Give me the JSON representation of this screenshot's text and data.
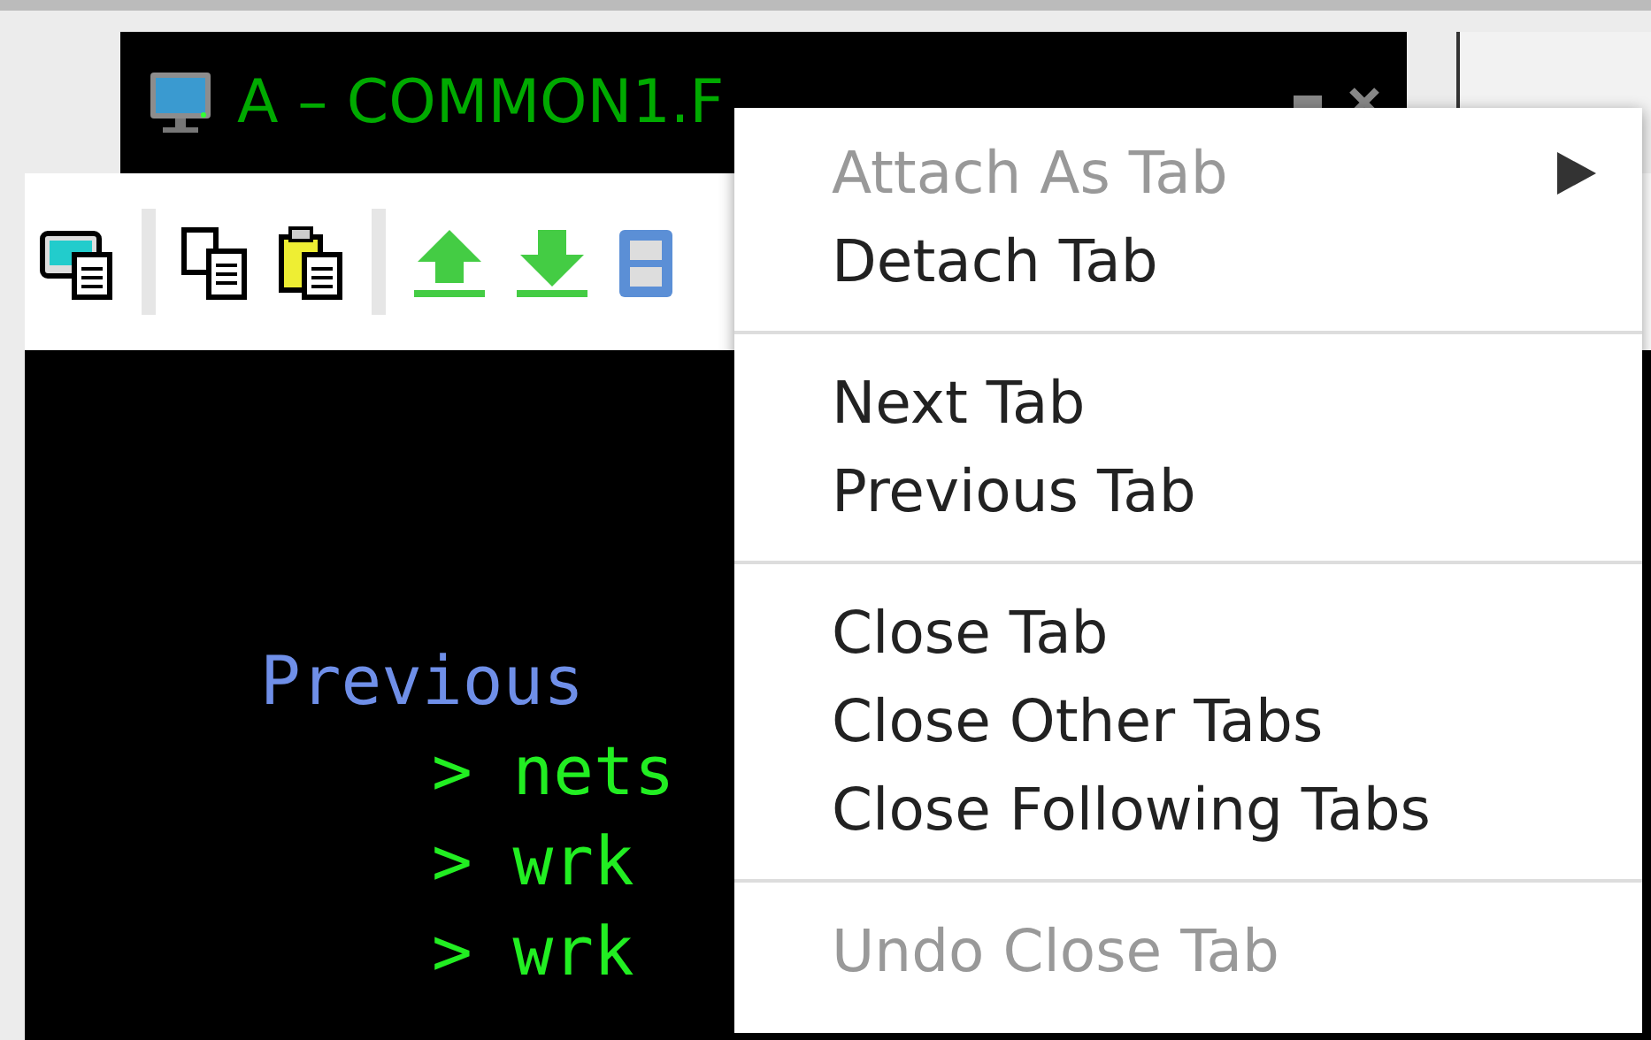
{
  "tab": {
    "title": "A – COMMON1.F"
  },
  "terminal": {
    "heading": "Previous",
    "lines": [
      {
        "prompt": ">",
        "text": "nets"
      },
      {
        "prompt": ">",
        "text": "wrk"
      },
      {
        "prompt": ">",
        "text": "wrk"
      }
    ]
  },
  "context_menu": {
    "items": [
      {
        "kind": "item",
        "label": "Attach As Tab",
        "disabled": true,
        "submenu": true
      },
      {
        "kind": "item",
        "label": "Detach Tab",
        "disabled": false,
        "submenu": false
      },
      {
        "kind": "separator"
      },
      {
        "kind": "item",
        "label": "Next Tab",
        "disabled": false,
        "submenu": false
      },
      {
        "kind": "item",
        "label": "Previous Tab",
        "disabled": false,
        "submenu": false
      },
      {
        "kind": "separator"
      },
      {
        "kind": "item",
        "label": "Close Tab",
        "disabled": false,
        "submenu": false
      },
      {
        "kind": "item",
        "label": "Close Other Tabs",
        "disabled": false,
        "submenu": false
      },
      {
        "kind": "item",
        "label": "Close Following Tabs",
        "disabled": false,
        "submenu": false
      },
      {
        "kind": "separator"
      },
      {
        "kind": "item",
        "label": "Undo Close Tab",
        "disabled": true,
        "submenu": false
      }
    ]
  }
}
